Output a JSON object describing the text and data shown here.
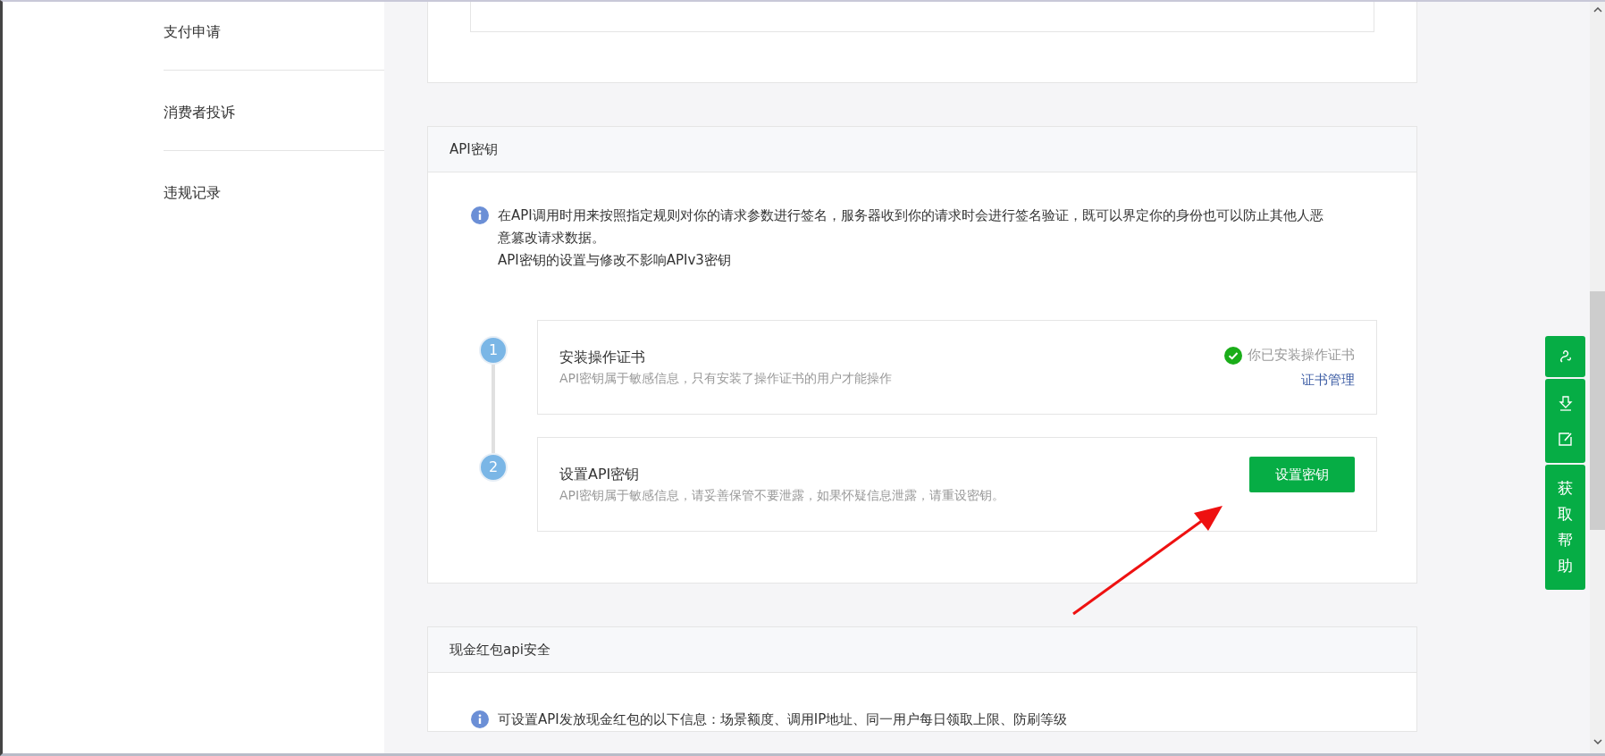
{
  "sidebar": {
    "items": [
      {
        "label": "支付申请"
      },
      {
        "label": "消费者投诉"
      },
      {
        "label": "违规记录"
      }
    ]
  },
  "api_key_section": {
    "title": "API密钥",
    "info": [
      "在API调用时用来按照指定规则对你的请求参数进行签名，服务器收到你的请求时会进行签名验证，既可以界定你的身份也可以防止其他人恶意篡改请求数据。",
      "API密钥的设置与修改不影响APIv3密钥"
    ],
    "steps": [
      {
        "kind": "status",
        "number": "1",
        "title": "安装操作证书",
        "description": "API密钥属于敏感信息，只有安装了操作证书的用户才能操作",
        "status": "你已安装操作证书",
        "link": "证书管理"
      },
      {
        "kind": "button",
        "number": "2",
        "title": "设置API密钥",
        "description": "API密钥属于敏感信息，请妥善保管不要泄露，如果怀疑信息泄露，请重设密钥。",
        "button": "设置密钥"
      }
    ]
  },
  "red_packet_section": {
    "title": "现金红包api安全",
    "info": "可设置API发放现金红包的以下信息：场景额度、调用IP地址、同一用户每日领取上限、防刷等级"
  },
  "help_panel": {
    "label": "获取帮助"
  }
}
